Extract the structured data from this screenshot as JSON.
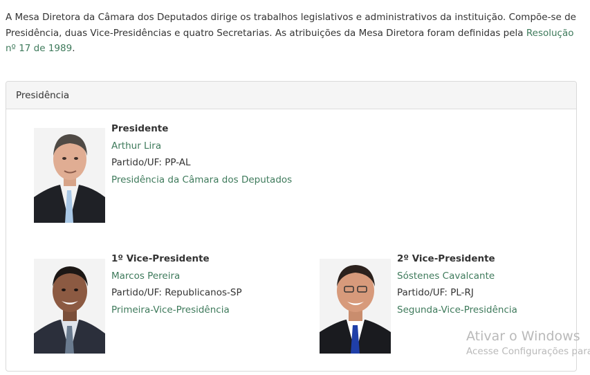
{
  "intro": {
    "text": "A Mesa Diretora da Câmara dos Deputados dirige os trabalhos legislativos e administrativos da instituição. Compõe-se de Presidência, duas Vice-Presidências e quatro Secretarias. As atribuições da Mesa Diretora foram definidas pela ",
    "link": "Resolução nº 17 de 1989",
    "suffix": "."
  },
  "panel": {
    "title": "Presidência"
  },
  "members": [
    {
      "role": "Presidente",
      "name": "Arthur Lira",
      "party": "Partido/UF: PP-AL",
      "office": "Presidência da Câmara dos Deputados",
      "tie_color": "#a9c8e6"
    },
    {
      "role": "1º Vice-Presidente",
      "name": "Marcos Pereira",
      "party": "Partido/UF: Republicanos-SP",
      "office": "Primeira-Vice-Presidência",
      "tie_color": "#6a7b8f"
    },
    {
      "role": "2º Vice-Presidente",
      "name": "Sóstenes Cavalcante",
      "party": "Partido/UF: PL-RJ",
      "office": "Segunda-Vice-Presidência",
      "tie_color": "#1f3fa8"
    }
  ],
  "watermark": {
    "line1": "Ativar o Windows",
    "line2": "Acesse Configurações para"
  }
}
